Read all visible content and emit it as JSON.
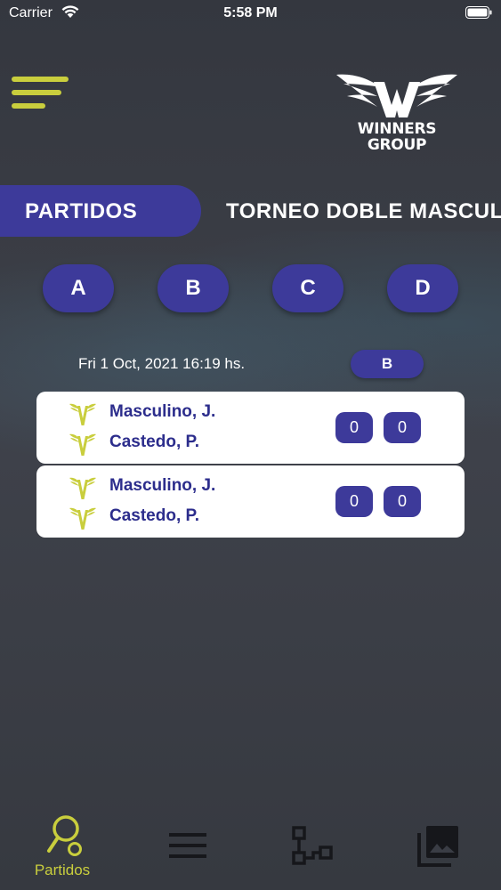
{
  "status_bar": {
    "carrier": "Carrier",
    "time": "5:58 PM"
  },
  "header": {
    "menu_icon": "hamburger-menu-icon",
    "logo_line1": "WINNERS",
    "logo_line2": "GROUP"
  },
  "tabs": [
    {
      "label": "PARTIDOS",
      "active": true
    },
    {
      "label": "TORNEO DOBLE MASCULINO",
      "active": false
    }
  ],
  "groups": [
    "A",
    "B",
    "C",
    "D"
  ],
  "match": {
    "date": "Fri 1 Oct, 2021 16:19 hs.",
    "group": "B"
  },
  "cards": [
    {
      "players": [
        {
          "name": "Masculino, J."
        },
        {
          "name": "Castedo, P."
        }
      ],
      "scores": [
        "0",
        "0"
      ]
    },
    {
      "players": [
        {
          "name": "Masculino, J."
        },
        {
          "name": "Castedo, P."
        }
      ],
      "scores": [
        "0",
        "0"
      ]
    }
  ],
  "bottom_nav": [
    {
      "label": "Partidos",
      "icon": "tennis-racket-icon",
      "active": true
    },
    {
      "label": "",
      "icon": "list-icon",
      "active": false
    },
    {
      "label": "",
      "icon": "bracket-icon",
      "active": false
    },
    {
      "label": "",
      "icon": "gallery-icon",
      "active": false
    }
  ],
  "colors": {
    "accent": "#c9ce3d",
    "primary": "#3d3a9a",
    "player_text": "#2c2d8c",
    "background": "#3a3d45"
  }
}
